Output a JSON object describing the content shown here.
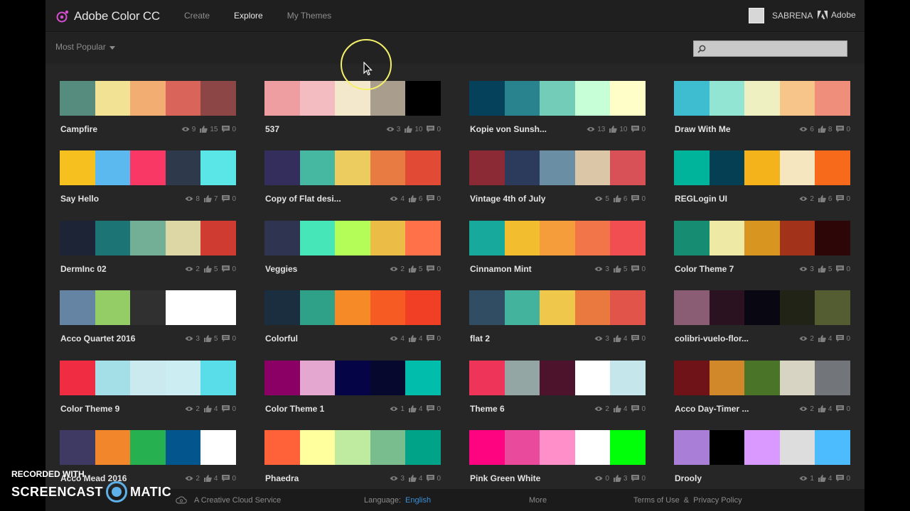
{
  "header": {
    "app_title": "Adobe Color CC",
    "nav": [
      {
        "label": "Create",
        "active": false
      },
      {
        "label": "Explore",
        "active": true
      },
      {
        "label": "My Themes",
        "active": false
      }
    ],
    "user_name": "SABRENA",
    "adobe_label": "Adobe"
  },
  "subbar": {
    "sort_label": "Most Popular",
    "search_placeholder": ""
  },
  "themes": [
    {
      "name": "Campfire",
      "views": "9",
      "likes": "15",
      "comments": "0",
      "colors": [
        "#558c7e",
        "#f2e293",
        "#f2ae72",
        "#d96459",
        "#8c4646"
      ]
    },
    {
      "name": "537",
      "views": "3",
      "likes": "10",
      "comments": "0",
      "colors": [
        "#ee9da1",
        "#f3bcc0",
        "#f4e8cc",
        "#a99d8e",
        "#000000"
      ]
    },
    {
      "name": "Kopie von Sunsh...",
      "views": "13",
      "likes": "10",
      "comments": "0",
      "colors": [
        "#05415a",
        "#29838f",
        "#73ccb8",
        "#c7ffd7",
        "#fffec8"
      ]
    },
    {
      "name": "Draw With Me",
      "views": "6",
      "likes": "8",
      "comments": "0",
      "colors": [
        "#3ebdd1",
        "#93e5d3",
        "#eef0c2",
        "#f7c589",
        "#ef8e7b"
      ]
    },
    {
      "name": "Say Hello",
      "views": "8",
      "likes": "7",
      "comments": "0",
      "colors": [
        "#f6c01e",
        "#5bb9ef",
        "#fa3866",
        "#2e3a4c",
        "#5ae6e6"
      ]
    },
    {
      "name": "Copy of Flat desi...",
      "views": "4",
      "likes": "6",
      "comments": "0",
      "colors": [
        "#342e5c",
        "#46b8a2",
        "#eccb5f",
        "#e87b41",
        "#e14b36"
      ]
    },
    {
      "name": "Vintage 4th of July",
      "views": "5",
      "likes": "6",
      "comments": "0",
      "colors": [
        "#8b2a35",
        "#2c3b5c",
        "#6a8ea4",
        "#dcc6a8",
        "#d85157"
      ]
    },
    {
      "name": "REGLogin UI",
      "views": "2",
      "likes": "6",
      "comments": "0",
      "colors": [
        "#00b39b",
        "#053f54",
        "#f4b21b",
        "#f5e6bf",
        "#f76a1c"
      ]
    },
    {
      "name": "DermInc 02",
      "views": "2",
      "likes": "5",
      "comments": "0",
      "colors": [
        "#1d2436",
        "#1c7574",
        "#72af96",
        "#ddd7a5",
        "#cf3a31"
      ]
    },
    {
      "name": "Veggies",
      "views": "2",
      "likes": "5",
      "comments": "0",
      "colors": [
        "#2f3551",
        "#47e6b9",
        "#b4fc58",
        "#ebbc46",
        "#fe7149"
      ]
    },
    {
      "name": "Cinnamon Mint",
      "views": "3",
      "likes": "5",
      "comments": "0",
      "colors": [
        "#17a99b",
        "#f2be30",
        "#f49d3a",
        "#f27449",
        "#f04e51"
      ]
    },
    {
      "name": "Color Theme 7",
      "views": "3",
      "likes": "5",
      "comments": "0",
      "colors": [
        "#168c73",
        "#eeeaa6",
        "#d8951f",
        "#a3321a",
        "#2d0707"
      ]
    },
    {
      "name": "Acco Quartet 2016",
      "views": "3",
      "likes": "5",
      "comments": "0",
      "colors": [
        "#6583a3",
        "#94cc66",
        "#303030",
        "#ffffff",
        "#ffffff"
      ]
    },
    {
      "name": "Colorful",
      "views": "4",
      "likes": "4",
      "comments": "0",
      "colors": [
        "#1a2e40",
        "#2fa189",
        "#f58a26",
        "#f55b23",
        "#f03f24"
      ]
    },
    {
      "name": "flat 2",
      "views": "3",
      "likes": "4",
      "comments": "0",
      "colors": [
        "#314d63",
        "#43b39e",
        "#efc84b",
        "#e9793e",
        "#e0544a"
      ]
    },
    {
      "name": "colibri-vuelo-flor...",
      "views": "2",
      "likes": "4",
      "comments": "0",
      "colors": [
        "#8a5d75",
        "#2b1220",
        "#090812",
        "#212316",
        "#545c32"
      ]
    },
    {
      "name": "Color Theme 9",
      "views": "2",
      "likes": "4",
      "comments": "0",
      "colors": [
        "#ef2c41",
        "#a4dfe8",
        "#cbeaef",
        "#cceef3",
        "#58dde9"
      ]
    },
    {
      "name": "Color Theme 1",
      "views": "1",
      "likes": "4",
      "comments": "0",
      "colors": [
        "#8a0064",
        "#e4a8d0",
        "#050447",
        "#07082e",
        "#00bdac"
      ]
    },
    {
      "name": "Theme 6",
      "views": "2",
      "likes": "4",
      "comments": "0",
      "colors": [
        "#ee3559",
        "#94a6a4",
        "#4d132c",
        "#ffffff",
        "#c5e6ea"
      ]
    },
    {
      "name": "Acco Day-Timer ...",
      "views": "2",
      "likes": "4",
      "comments": "0",
      "colors": [
        "#6f1318",
        "#d0882b",
        "#4a7529",
        "#d8d4c4",
        "#727579"
      ]
    },
    {
      "name": "Acco Mead 2016",
      "views": "2",
      "likes": "4",
      "comments": "0",
      "colors": [
        "#3e3a63",
        "#f2862a",
        "#27b04f",
        "#03558e",
        "#ffffff"
      ]
    },
    {
      "name": "Phaedra",
      "views": "3",
      "likes": "4",
      "comments": "0",
      "colors": [
        "#ff6138",
        "#ffff9d",
        "#beeb9f",
        "#79bd8f",
        "#00a388"
      ]
    },
    {
      "name": "Pink Green White",
      "views": "0",
      "likes": "3",
      "comments": "0",
      "colors": [
        "#ff0481",
        "#ea4a9b",
        "#ff8fc9",
        "#ffffff",
        "#00ff08"
      ]
    },
    {
      "name": "Drooly",
      "views": "1",
      "likes": "4",
      "comments": "0",
      "colors": [
        "#a97ed6",
        "#000000",
        "#d999ff",
        "#dddddd",
        "#4dbcff"
      ]
    }
  ],
  "footer": {
    "cc_label": "A Creative Cloud Service",
    "language_label": "Language:",
    "language_value": "English",
    "more_label": "More",
    "terms_label": "Terms of Use",
    "amp": "&",
    "privacy_label": "Privacy Policy"
  },
  "watermark": {
    "line1": "RECORDED WITH",
    "line2a": "SCREENCAST",
    "line2b": "MATIC"
  },
  "colors": {
    "accent": "#3b8fd8",
    "brand_magenta": "#d84fd2",
    "cursor_highlight": "#f5f06a"
  }
}
